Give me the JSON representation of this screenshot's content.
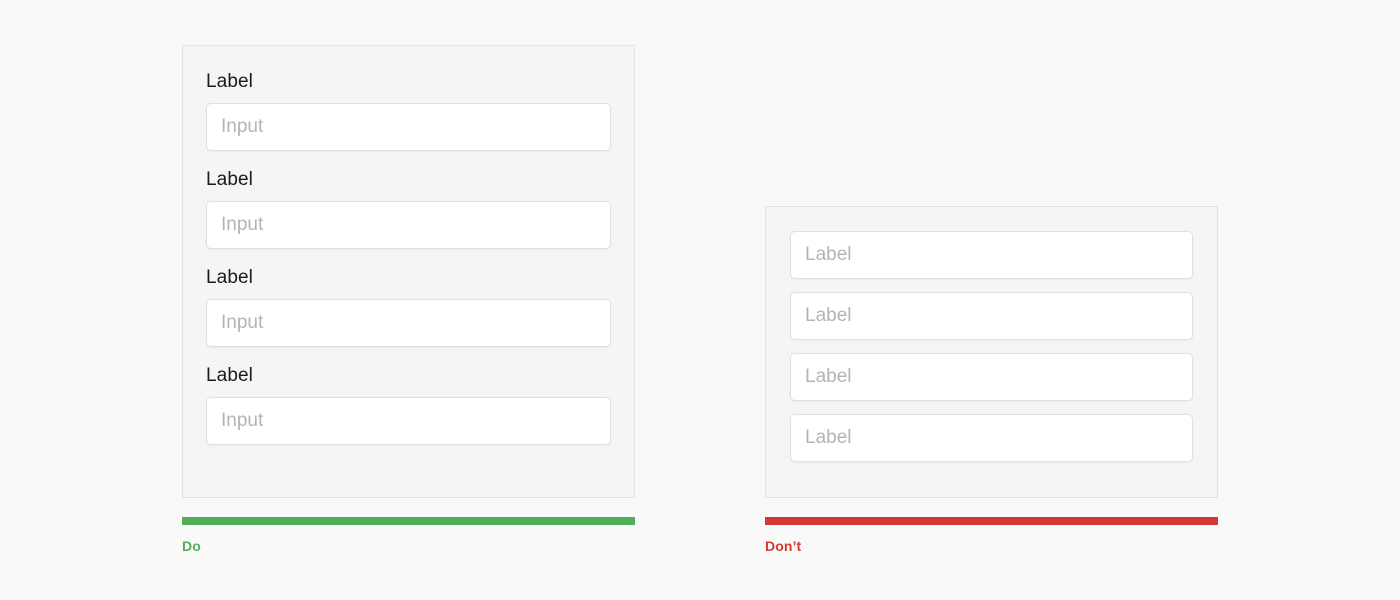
{
  "page": {
    "background_color": "#f9f9f9"
  },
  "examples": [
    {
      "id": "do",
      "verdict_label": "Do",
      "verdict_color": "#52ae5b",
      "panel": {
        "background_color": "#f5f5f5",
        "border_color": "#e3e3e3"
      },
      "pattern": "label-above-input",
      "fields": [
        {
          "label": "Label",
          "placeholder": "Input",
          "value": ""
        },
        {
          "label": "Label",
          "placeholder": "Input",
          "value": ""
        },
        {
          "label": "Label",
          "placeholder": "Input",
          "value": ""
        },
        {
          "label": "Label",
          "placeholder": "Input",
          "value": ""
        }
      ]
    },
    {
      "id": "dont",
      "verdict_label": "Don’t",
      "verdict_color": "#d33a35",
      "panel": {
        "background_color": "#f5f5f5",
        "border_color": "#e3e3e3"
      },
      "pattern": "label-as-placeholder",
      "fields": [
        {
          "label": "",
          "placeholder": "Label",
          "value": ""
        },
        {
          "label": "",
          "placeholder": "Label",
          "value": ""
        },
        {
          "label": "",
          "placeholder": "Label",
          "value": ""
        },
        {
          "label": "",
          "placeholder": "Label",
          "value": ""
        }
      ]
    }
  ]
}
